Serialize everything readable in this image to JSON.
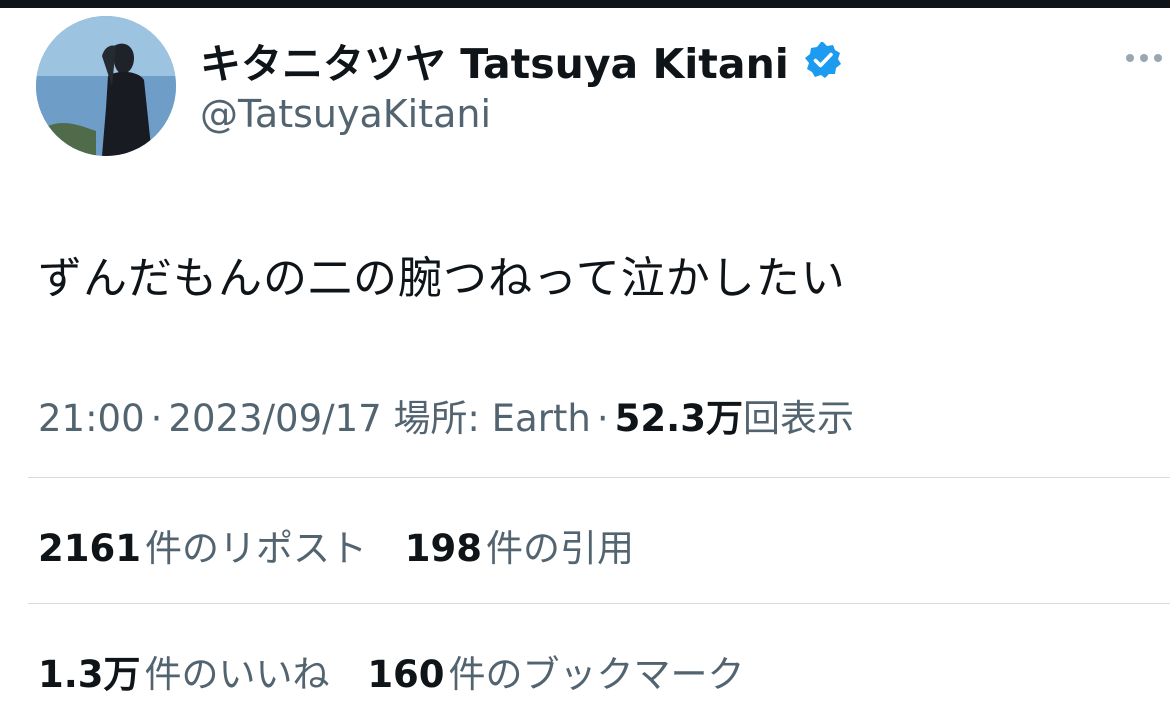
{
  "profile": {
    "display_name": "キタニタツヤ Tatsuya Kitani",
    "handle": "@TatsuyaKitani",
    "verified": true,
    "verified_color": "#1d9bf0",
    "avatar_icon": "profile-photo"
  },
  "more_icon": "more-horizontal-icon",
  "tweet": {
    "text": "ずんだもんの二の腕つねって泣かしたい"
  },
  "meta": {
    "time": "21:00",
    "separator": "·",
    "date": "2023/09/17",
    "location": "場所: Earth",
    "views_count": "52.3万",
    "views_label": "回表示"
  },
  "stats": {
    "reposts_count": "2161",
    "reposts_label": "件のリポスト",
    "quotes_count": "198",
    "quotes_label": "件の引用",
    "likes_count": "1.3万",
    "likes_label": "件のいいね",
    "bookmarks_count": "160",
    "bookmarks_label": "件のブックマーク"
  },
  "colors": {
    "text_primary": "#0f1419",
    "text_secondary": "#536471",
    "divider": "#d6dbe0"
  }
}
